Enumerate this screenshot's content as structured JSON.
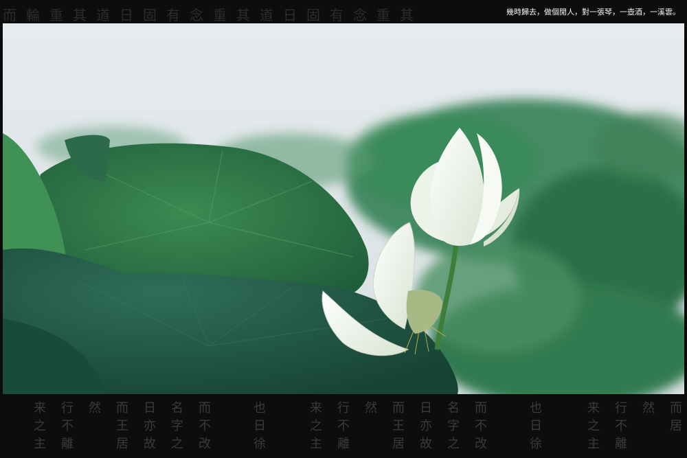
{
  "caption": "幾時歸去，做個閒人，對一張琴，一壺酒，一溪雲。",
  "top_band_text": "而輪重其道日固有念重其道日固有念重其",
  "bottom_columns": [
    "来之主",
    "行不離",
    "然",
    "而王居",
    "日亦故",
    "名字之",
    "而不改",
    "也日徐",
    "来之主",
    "行不離",
    "然",
    "而王居",
    "日亦故",
    "名字之",
    "而不改",
    "也日徐",
    "来之主",
    "行不離",
    "然",
    "而居"
  ],
  "colors": {
    "sky": "#e9edf0",
    "leaf_dark": "#1f5a3e",
    "leaf_mid": "#2f7a4c",
    "leaf_light": "#4a9a5c",
    "petal": "#f3f6f2",
    "band": "#0d0d0d"
  }
}
